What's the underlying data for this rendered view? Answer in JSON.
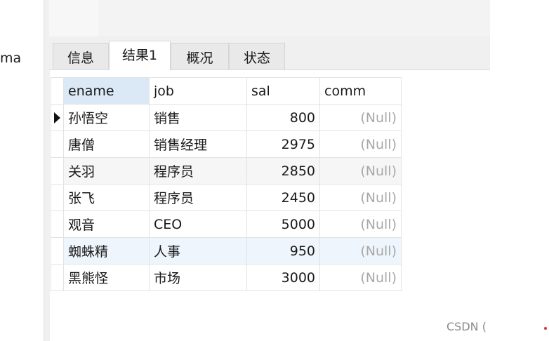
{
  "sidebar": {
    "label": "ma"
  },
  "tabs": [
    {
      "label": "信息",
      "active": false
    },
    {
      "label": "结果1",
      "active": true
    },
    {
      "label": "概况",
      "active": false
    },
    {
      "label": "状态",
      "active": false
    }
  ],
  "grid": {
    "columns": [
      "ename",
      "job",
      "sal",
      "comm"
    ],
    "rows": [
      {
        "ename": "孙悟空",
        "job": "销售",
        "sal": "800",
        "comm": "(Null)"
      },
      {
        "ename": "唐僧",
        "job": "销售经理",
        "sal": "2975",
        "comm": "(Null)"
      },
      {
        "ename": "关羽",
        "job": "程序员",
        "sal": "2850",
        "comm": "(Null)"
      },
      {
        "ename": "张飞",
        "job": "程序员",
        "sal": "2450",
        "comm": "(Null)"
      },
      {
        "ename": "观音",
        "job": "CEO",
        "sal": "5000",
        "comm": "(Null)"
      },
      {
        "ename": "蜘蛛精",
        "job": "人事",
        "sal": "950",
        "comm": "(Null)"
      },
      {
        "ename": "黑熊怪",
        "job": "市场",
        "sal": "3000",
        "comm": "(Null)"
      }
    ]
  },
  "watermark": "CSDN ("
}
